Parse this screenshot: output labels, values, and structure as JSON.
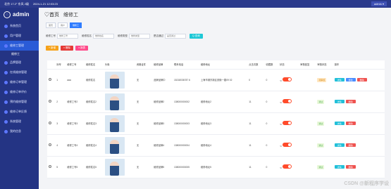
{
  "topbar": {
    "left": "北京 17.2° 东风 2级",
    "center": "2024-1-21 12:03:23",
    "right": "admin ▾"
  },
  "sidebar": {
    "logo": "admin",
    "items": [
      {
        "label": "系统首页",
        "icon": "home-icon",
        "active": false
      },
      {
        "label": "用户管理",
        "icon": "user-icon",
        "active": false
      },
      {
        "label": "维修工管理",
        "icon": "wrench-icon",
        "active": true
      },
      {
        "label": "维修工",
        "icon": "",
        "sub": true
      },
      {
        "label": "品牌管理",
        "icon": "tag-icon",
        "active": false
      },
      {
        "label": "在线维修管理",
        "icon": "tool-icon",
        "active": false
      },
      {
        "label": "维修订单管理",
        "icon": "list-icon",
        "active": false
      },
      {
        "label": "维修订单评价",
        "icon": "star-icon",
        "active": false
      },
      {
        "label": "预约维修管理",
        "icon": "calendar-icon",
        "active": false
      },
      {
        "label": "维修订单反馈",
        "icon": "feedback-icon",
        "active": false
      },
      {
        "label": "系统管理",
        "icon": "settings-icon",
        "active": false
      },
      {
        "label": "我的信息",
        "icon": "profile-icon",
        "active": false
      }
    ]
  },
  "header": {
    "home": "♡首页",
    "current": "维修工"
  },
  "tabs": [
    "首页",
    "用户",
    "维修工"
  ],
  "search": {
    "fields": [
      {
        "label": "维修工号",
        "placeholder": "维修工号"
      },
      {
        "label": "维修姓名",
        "placeholder": "维修姓名"
      },
      {
        "label": "维修类型",
        "placeholder": "维修类型"
      },
      {
        "label": "是否通过",
        "placeholder": "是否通过"
      }
    ],
    "button": "Q 查询"
  },
  "actions": {
    "add": "+ 新增",
    "delete": "× 删除",
    "export": "≡ 报表"
  },
  "table": {
    "headers": [
      "",
      "序号",
      "维修工号",
      "维修姓名",
      "头像",
      "资格证件",
      "维修品牌",
      "联系电话",
      "维修地址",
      "点击次数",
      "收藏数",
      "状态",
      "审核回复",
      "审核状态",
      "操作"
    ],
    "rows": [
      {
        "id": "1",
        "code": "aaa",
        "name": "维修姓名",
        "cert": "无",
        "brand": "品牌品牌中",
        "phone": "15218036787 6",
        "addr": "上海市浦东新区张衡一路09 02",
        "clicks": "0",
        "fav": "0",
        "status": "",
        "reply": "",
        "audit": "待审核",
        "ops": [
          "详情",
          "修改",
          "删除"
        ]
      },
      {
        "id": "2",
        "code": "维修工号2",
        "name": "维修姓名2",
        "cert": "无",
        "brand": "维修品牌2",
        "phone": "138000000002",
        "addr": "维修地址2",
        "clicks": "11",
        "fav": "0",
        "status": "",
        "reply": "",
        "audit": "通过",
        "ops": [
          "详情",
          "删除"
        ]
      },
      {
        "id": "3",
        "code": "维修工号3",
        "name": "维修姓名3",
        "cert": "无",
        "brand": "维修品牌3",
        "phone": "138000000003",
        "addr": "维修地址3",
        "clicks": "11",
        "fav": "0",
        "status": "",
        "reply": "",
        "audit": "通过",
        "ops": [
          "详情",
          "删除"
        ]
      },
      {
        "id": "4",
        "code": "维修工号4",
        "name": "维修姓名4",
        "cert": "无",
        "brand": "维修品牌4",
        "phone": "138000000004",
        "addr": "维修地址4",
        "clicks": "11",
        "fav": "0",
        "status": "",
        "reply": "",
        "audit": "通过",
        "ops": [
          "详情",
          "删除"
        ]
      },
      {
        "id": "5",
        "code": "维修工号5",
        "name": "维修姓名5",
        "cert": "无",
        "brand": "维修品牌5",
        "phone": "138000000005",
        "addr": "维修地址5",
        "clicks": "11",
        "fav": "0",
        "status": "",
        "reply": "",
        "audit": "通过",
        "ops": [
          "详情",
          "删除"
        ]
      }
    ]
  },
  "watermark": "CSDN @新程序学设"
}
